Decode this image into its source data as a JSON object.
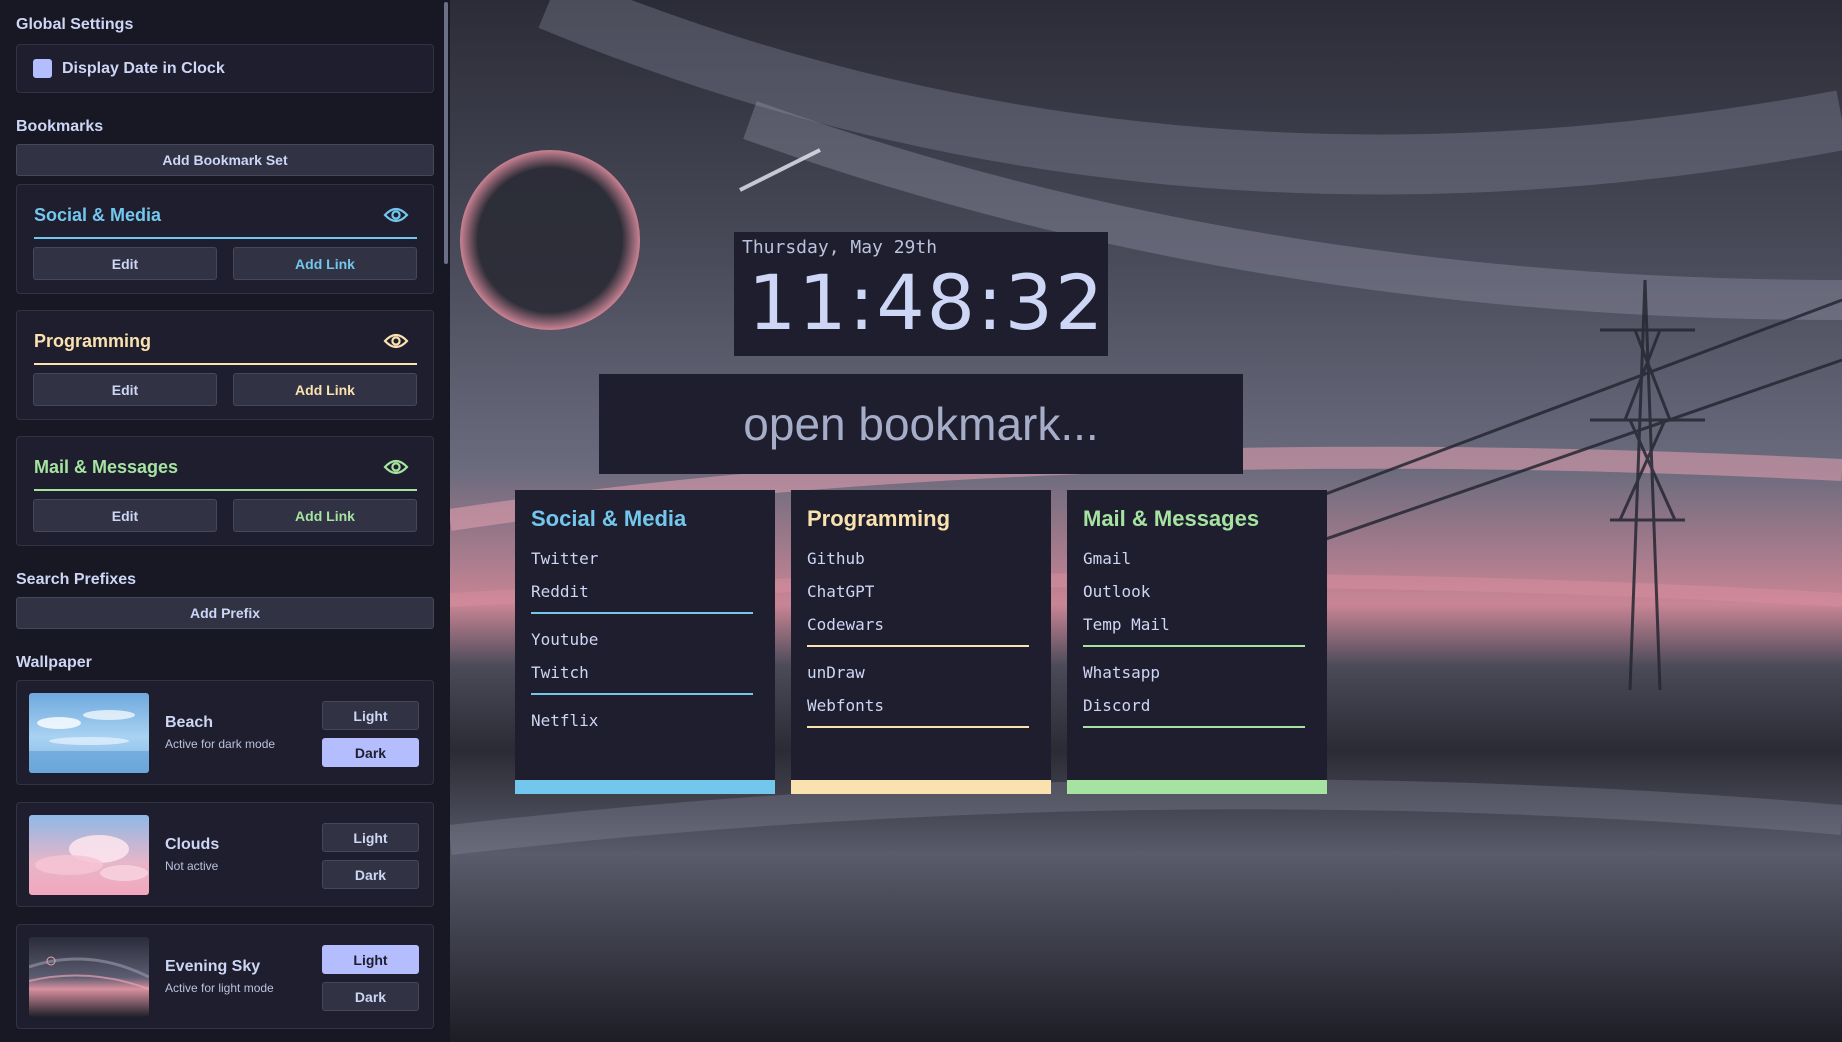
{
  "sidebar": {
    "global_settings": {
      "heading": "Global Settings",
      "display_date_label": "Display Date in Clock",
      "display_date_checked": true
    },
    "bookmarks": {
      "heading": "Bookmarks",
      "add_set_label": "Add Bookmark Set",
      "sets": [
        {
          "title": "Social & Media",
          "color": "#74c7ec",
          "edit_label": "Edit",
          "add_link_label": "Add Link",
          "visibility_icon": "eye-icon"
        },
        {
          "title": "Programming",
          "color": "#f9e2af",
          "edit_label": "Edit",
          "add_link_label": "Add Link",
          "visibility_icon": "eye-icon"
        },
        {
          "title": "Mail & Messages",
          "color": "#a6e3a1",
          "edit_label": "Edit",
          "add_link_label": "Add Link",
          "visibility_icon": "eye-icon"
        }
      ]
    },
    "search_prefixes": {
      "heading": "Search Prefixes",
      "add_prefix_label": "Add Prefix"
    },
    "wallpaper": {
      "heading": "Wallpaper",
      "items": [
        {
          "name": "Beach",
          "status": "Active for dark mode",
          "light_label": "Light",
          "dark_label": "Dark",
          "active_mode": "dark"
        },
        {
          "name": "Clouds",
          "status": "Not active",
          "light_label": "Light",
          "dark_label": "Dark",
          "active_mode": "none"
        },
        {
          "name": "Evening Sky",
          "status": "Active for light mode",
          "light_label": "Light",
          "dark_label": "Dark",
          "active_mode": "light"
        }
      ]
    }
  },
  "clock": {
    "date": "Thursday, May 29th",
    "time": "11:48:32"
  },
  "search": {
    "placeholder": "open bookmark..."
  },
  "cards": [
    {
      "title": "Social & Media",
      "color": "#74c7ec",
      "groups": [
        [
          "Twitter",
          "Reddit"
        ],
        [
          "Youtube",
          "Twitch"
        ],
        [
          "Netflix"
        ]
      ]
    },
    {
      "title": "Programming",
      "color": "#f9e2af",
      "groups": [
        [
          "Github",
          "ChatGPT",
          "Codewars"
        ],
        [
          "unDraw",
          "Webfonts"
        ]
      ]
    },
    {
      "title": "Mail & Messages",
      "color": "#a6e3a1",
      "groups": [
        [
          "Gmail",
          "Outlook",
          "Temp Mail"
        ],
        [
          "Whatsapp",
          "Discord"
        ]
      ]
    }
  ],
  "colors": {
    "accent": "#b4befe",
    "panel": "#1e1e2e",
    "sidebar": "#181825"
  }
}
